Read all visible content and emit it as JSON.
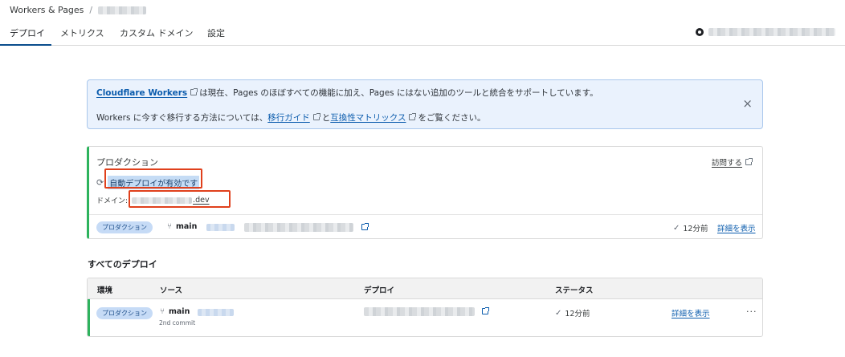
{
  "breadcrumb": {
    "root": "Workers & Pages",
    "separator": "/"
  },
  "tabs": [
    {
      "label": "デプロイ"
    },
    {
      "label": "メトリクス"
    },
    {
      "label": "カスタム ドメイン"
    },
    {
      "label": "設定"
    }
  ],
  "banner": {
    "line1_link": "Cloudflare Workers",
    "line1_text": "は現在、Pages のほぼすべての機能に加え、Pages にはない追加のツールと統合をサポートしています。",
    "line2_prefix": "Workers に今すぐ移行する方法については、",
    "line2_link1": "移行ガイド",
    "line2_mid": "と",
    "line2_link2": "互換性マトリックス",
    "line2_suffix": "をご覧ください。",
    "close": "×"
  },
  "production": {
    "title": "プロダクション",
    "visit": "訪問する",
    "auto_deploy": "自動デプロイが有効です",
    "domain_label": "ドメイン:",
    "domain_suffix": ".dev",
    "badge": "プロダクション",
    "branch": "main",
    "time": "12分前",
    "details": "詳細を表示"
  },
  "all_deploys": {
    "title": "すべてのデプロイ",
    "headers": {
      "env": "環境",
      "source": "ソース",
      "deploy": "デプロイ",
      "status": "ステータス"
    },
    "rows": [
      {
        "badge": "プロダクション",
        "branch": "main",
        "commit": "2nd commit",
        "time": "12分前",
        "details": "詳細を表示",
        "more": "···"
      }
    ]
  },
  "icons": {
    "refresh": "refresh-icon",
    "branch": "git-branch-icon",
    "check": "check-icon",
    "external": "external-link-icon",
    "github": "github-icon"
  },
  "colors": {
    "accent": "#0b5cad",
    "success": "#2db35d",
    "highlight_box": "#e0401c",
    "banner_bg": "#eaf2fd"
  }
}
